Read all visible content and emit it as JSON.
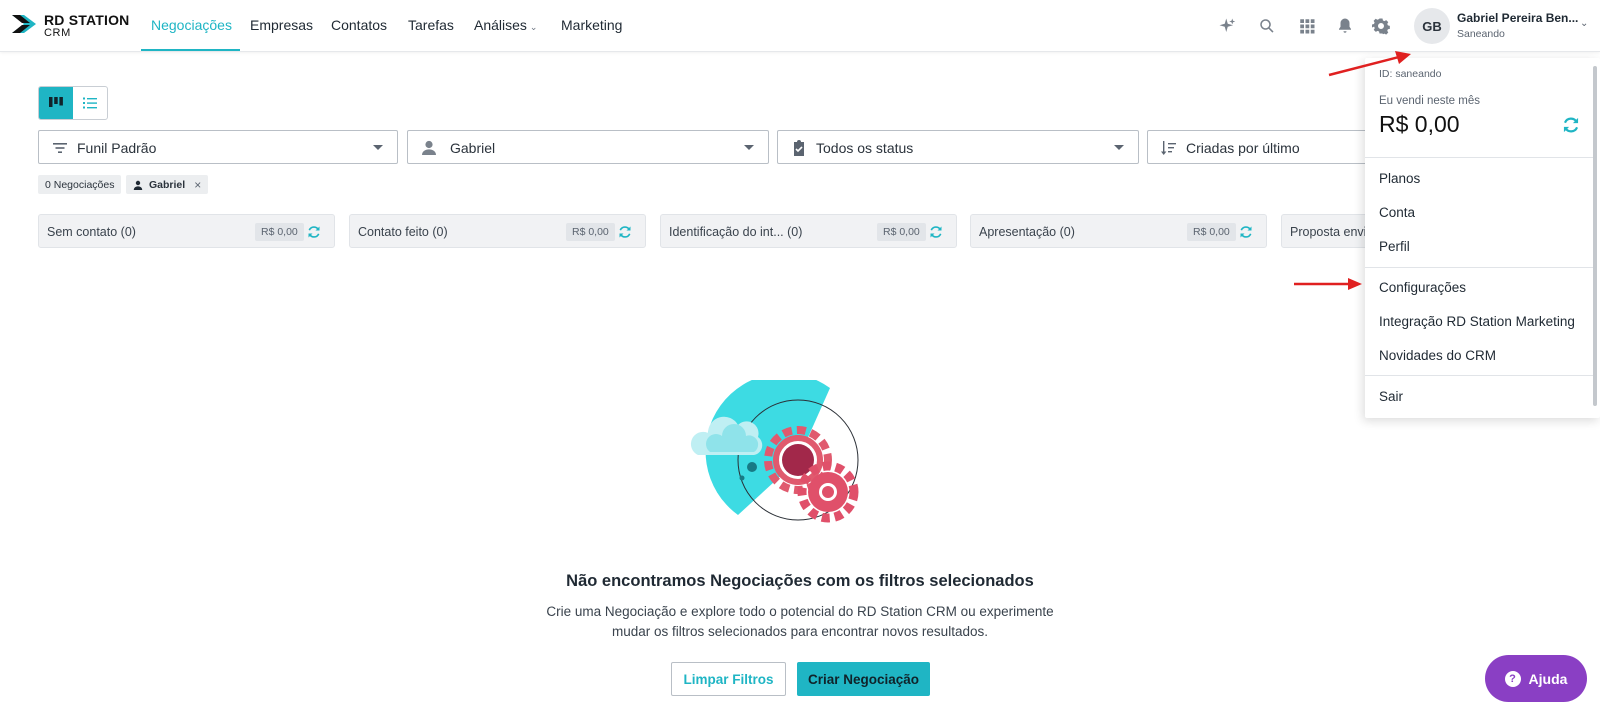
{
  "brand": {
    "line1": "RD STATION",
    "line2": "CRM"
  },
  "nav": [
    {
      "label": "Negociações",
      "active": true
    },
    {
      "label": "Empresas"
    },
    {
      "label": "Contatos"
    },
    {
      "label": "Tarefas"
    },
    {
      "label": "Análises",
      "has_dropdown": true
    },
    {
      "label": "Marketing"
    }
  ],
  "top_icons": [
    "sparkle-icon",
    "search-icon",
    "apps-grid-icon",
    "bell-icon",
    "gear-icon"
  ],
  "user": {
    "initials": "GB",
    "name": "Gabriel Pereira Ben...",
    "org": "Saneando"
  },
  "filters": [
    {
      "label": "Funil Padrão",
      "icon": "filter-lines-icon"
    },
    {
      "label": "Gabriel",
      "icon": "person-icon"
    },
    {
      "label": "Todos os status",
      "icon": "clipboard-check-icon"
    },
    {
      "label": "Criadas por último",
      "icon": "sort-icon"
    }
  ],
  "chips": {
    "count": "0 Negociações",
    "user": "Gabriel"
  },
  "stages": [
    {
      "name": "Sem contato (0)",
      "value": "R$ 0,00"
    },
    {
      "name": "Contato feito (0)",
      "value": "R$ 0,00"
    },
    {
      "name": "Identificação do int...  (0)",
      "value": "R$ 0,00"
    },
    {
      "name": "Apresentação (0)",
      "value": "R$ 0,00"
    },
    {
      "name": "Proposta envia",
      "value": ""
    }
  ],
  "empty": {
    "title": "Não encontramos Negociações com os filtros selecionados",
    "subtitle": "Crie uma Negociação e explore todo o potencial do RD Station CRM ou experimente mudar os filtros selecionados para encontrar novos resultados.",
    "clear_button": "Limpar Filtros",
    "create_button": "Criar Negociação"
  },
  "help": {
    "label": "Ajuda"
  },
  "dropdown": {
    "id_text": "ID: saneando",
    "sold_label": "Eu vendi neste mês",
    "sold_value": "R$ 0,00",
    "group1": [
      "Planos",
      "Conta",
      "Perfil"
    ],
    "group2": [
      "Configurações",
      "Integração RD Station Marketing",
      "Novidades do CRM"
    ],
    "group3": [
      "Sair"
    ]
  },
  "colors": {
    "accent": "#1fb5c4",
    "help": "#8a3fc4",
    "annotation_arrow": "#e02020"
  }
}
